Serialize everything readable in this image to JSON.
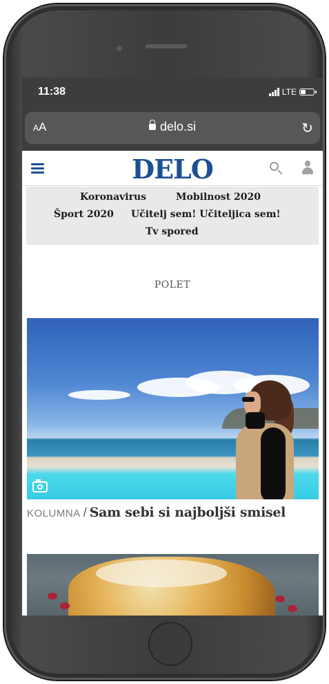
{
  "status_bar": {
    "time": "11:38",
    "network": "LTE"
  },
  "browser": {
    "text_size_label_small": "A",
    "text_size_label_large": "A",
    "url": "delo.si"
  },
  "site": {
    "logo": "DELO"
  },
  "topics": [
    "Koronavirus",
    "Mobilnost 2020",
    "Šport 2020",
    "Učitelj sem! Učiteljica sem!",
    "Tv spored"
  ],
  "section": {
    "label": "POLET"
  },
  "article": {
    "kicker": "KOLUMNA",
    "separator": "/",
    "title": "Sam sebi si najboljši smisel"
  },
  "colors": {
    "brand": "#1d4f93",
    "topic_bg": "#e9e9e9",
    "status_bg": "#3d3d3d"
  },
  "icons": [
    "hamburger-icon",
    "search-icon",
    "user-icon",
    "lock-icon",
    "reload-icon",
    "camera-icon",
    "signal-icon",
    "battery-icon"
  ]
}
